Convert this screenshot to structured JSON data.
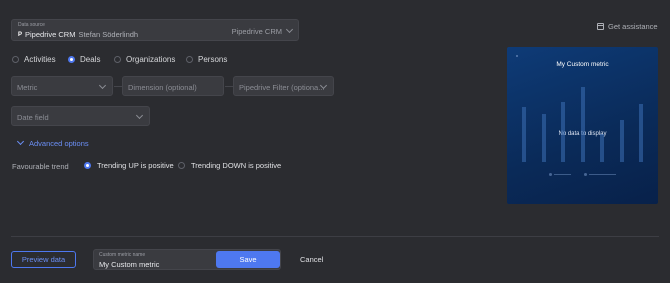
{
  "data_source": {
    "caption": "Data source",
    "app": "Pipedrive CRM",
    "user": "Stefan Söderlindh",
    "selected": "Pipedrive CRM"
  },
  "assist": {
    "label": "Get assistance"
  },
  "entity_types": [
    {
      "label": "Activities",
      "selected": false
    },
    {
      "label": "Deals",
      "selected": true
    },
    {
      "label": "Organizations",
      "selected": false
    },
    {
      "label": "Persons",
      "selected": false
    }
  ],
  "selects": {
    "metric": "Metric",
    "dimension": "Dimension (optional)",
    "filter": "Pipedrive Filter (optiona...",
    "date_field": "Date field"
  },
  "advanced": {
    "label": "Advanced options"
  },
  "favourable_trend": {
    "label": "Favourable trend",
    "up": "Trending UP is positive",
    "down": "Trending DOWN is positive",
    "selected": "up"
  },
  "preview_card": {
    "title": "My Custom metric",
    "empty": "No data to display",
    "bar_levels": [
      0.55,
      0.48,
      0.6,
      0.75,
      0.28,
      0.42,
      0.58
    ]
  },
  "footer": {
    "preview": "Preview data",
    "name_caption": "Custom metric name",
    "name_value": "My Custom metric",
    "save": "Save",
    "cancel": "Cancel"
  },
  "colors": {
    "accent": "#4e78f0",
    "background": "#2b2c30",
    "card": "#0e3b77"
  }
}
